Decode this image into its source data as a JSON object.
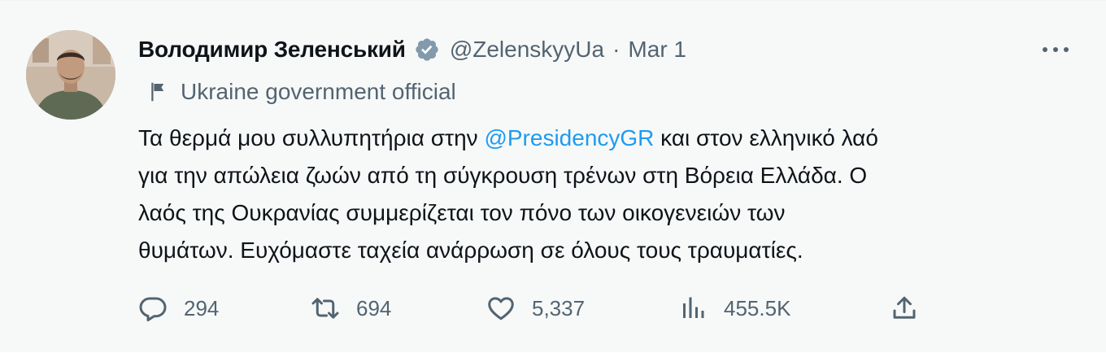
{
  "tweet": {
    "author_name": "Володимир Зеленський",
    "handle": "@ZelenskyyUa",
    "separator": "·",
    "date": "Mar 1",
    "affiliation": "Ukraine government official",
    "body_lines": [
      {
        "before": "Τα θερμά μου συλλυπητήρια στην ",
        "mention": "@PresidencyGR",
        "after": " και στον ελληνικό λαό"
      },
      {
        "before": "για την απώλεια ζωών από τη σύγκρουση τρένων στη Βόρεια Ελλάδα. Ο",
        "mention": "",
        "after": ""
      },
      {
        "before": "λαός της Ουκρανίας συμμερίζεται τον πόνο των οικογενειών των",
        "mention": "",
        "after": ""
      },
      {
        "before": "θυμάτων. Ευχόμαστε ταχεία ανάρρωση σε όλους τους τραυματίες.",
        "mention": "",
        "after": ""
      }
    ],
    "stats": {
      "replies": "294",
      "retweets": "694",
      "likes": "5,337",
      "views": "455.5K"
    }
  },
  "icons": {
    "verified": "verified-badge-icon",
    "more": "more-dots-icon",
    "affiliation": "flag-icon",
    "reply": "reply-icon",
    "retweet": "retweet-icon",
    "like": "heart-icon",
    "views": "views-chart-icon",
    "share": "share-icon"
  },
  "colors": {
    "text": "#0f1419",
    "secondary": "#536471",
    "mention": "#1d9bf0",
    "background": "#f7f9f9"
  }
}
